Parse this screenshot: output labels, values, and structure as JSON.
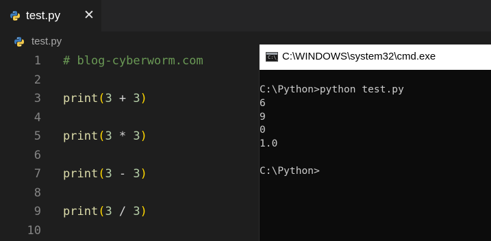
{
  "editor": {
    "tab": {
      "label": "test.py",
      "icon": "python-icon",
      "close_glyph": "✕"
    },
    "breadcrumb": {
      "label": "test.py",
      "icon": "python-icon"
    },
    "lines": [
      {
        "number": "1",
        "tokens": [
          {
            "t": "# blog-cyberworm.com",
            "k": "comment"
          }
        ]
      },
      {
        "number": "2",
        "tokens": []
      },
      {
        "number": "3",
        "tokens": [
          {
            "t": "print",
            "k": "fn"
          },
          {
            "t": "(",
            "k": "paren"
          },
          {
            "t": "3",
            "k": "num"
          },
          {
            "t": " + ",
            "k": "op"
          },
          {
            "t": "3",
            "k": "num"
          },
          {
            "t": ")",
            "k": "paren"
          }
        ]
      },
      {
        "number": "4",
        "tokens": []
      },
      {
        "number": "5",
        "tokens": [
          {
            "t": "print",
            "k": "fn"
          },
          {
            "t": "(",
            "k": "paren"
          },
          {
            "t": "3",
            "k": "num"
          },
          {
            "t": " * ",
            "k": "op"
          },
          {
            "t": "3",
            "k": "num"
          },
          {
            "t": ")",
            "k": "paren"
          }
        ]
      },
      {
        "number": "6",
        "tokens": []
      },
      {
        "number": "7",
        "tokens": [
          {
            "t": "print",
            "k": "fn"
          },
          {
            "t": "(",
            "k": "paren"
          },
          {
            "t": "3",
            "k": "num"
          },
          {
            "t": " - ",
            "k": "op"
          },
          {
            "t": "3",
            "k": "num"
          },
          {
            "t": ")",
            "k": "paren"
          }
        ]
      },
      {
        "number": "8",
        "tokens": []
      },
      {
        "number": "9",
        "tokens": [
          {
            "t": "print",
            "k": "fn"
          },
          {
            "t": "(",
            "k": "paren"
          },
          {
            "t": "3",
            "k": "num"
          },
          {
            "t": " / ",
            "k": "op"
          },
          {
            "t": "3",
            "k": "num"
          },
          {
            "t": ")",
            "k": "paren"
          }
        ]
      },
      {
        "number": "10",
        "tokens": []
      }
    ]
  },
  "cmd": {
    "title": "C:\\WINDOWS\\system32\\cmd.exe",
    "icon_text": "C:\\_",
    "lines": [
      "C:\\Python>python test.py",
      "6",
      "9",
      "0",
      "1.0",
      "",
      "C:\\Python>"
    ]
  },
  "colors": {
    "editor_bg": "#1e1e1e",
    "tabbar_bg": "#252526",
    "comment": "#6a9955",
    "function": "#dcdcaa",
    "paren": "#ffd700",
    "number": "#b5cea8",
    "terminal_bg": "#0c0c0c",
    "terminal_fg": "#cccccc"
  }
}
